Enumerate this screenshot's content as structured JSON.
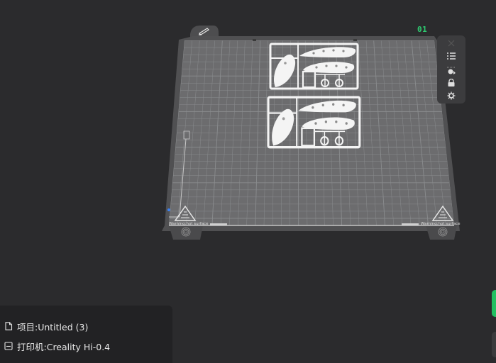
{
  "plate": {
    "id_label": "01",
    "warning_text": "Warning:hot surface",
    "icons": {
      "top_tab": "edit-pencil-icon",
      "list": "object-list-icon",
      "auto_arrange": "auto-arrange-icon",
      "lock": "lock-icon",
      "settings": "gear-icon",
      "warning": "hot-surface-warning-icon",
      "fingerprint": "fingerprint-icon"
    }
  },
  "project": {
    "project_label": "项目:Untitled (3)",
    "printer_label": "打印机:Creality Hi-0.4"
  },
  "colors": {
    "background": "#2b2b2d",
    "plate_frame": "#505052",
    "plate_bed": "#6c6c6e",
    "grid": "#888a8c",
    "model": "#f4f4f4",
    "accent_green": "#22c061",
    "plate_id": "#2ecc71"
  }
}
